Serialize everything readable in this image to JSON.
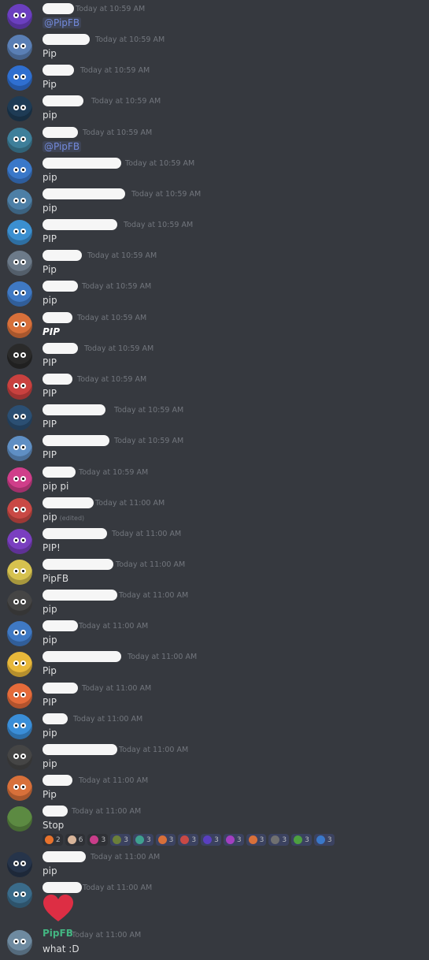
{
  "channel": {
    "messages": [
      {
        "time": "Today at 10:59 AM",
        "text": "@PipFB",
        "mention": true
      },
      {
        "time": "Today at 10:59 AM",
        "text": "Pip"
      },
      {
        "time": "Today at 10:59 AM",
        "text": "Pip"
      },
      {
        "time": "Today at 10:59 AM",
        "text": "pip"
      },
      {
        "time": "Today at 10:59 AM",
        "text": "@PipFB",
        "mention": true
      },
      {
        "time": "Today at 10:59 AM",
        "text": "pip"
      },
      {
        "time": "Today at 10:59 AM",
        "text": "pip"
      },
      {
        "time": "Today at 10:59 AM",
        "text": "PIP"
      },
      {
        "time": "Today at 10:59 AM",
        "text": "Pip"
      },
      {
        "time": "Today at 10:59 AM",
        "text": "pip"
      },
      {
        "time": "Today at 10:59 AM",
        "text": "PIP",
        "bold": true
      },
      {
        "time": "Today at 10:59 AM",
        "text": "PIP"
      },
      {
        "time": "Today at 10:59 AM",
        "text": "PIP"
      },
      {
        "time": "Today at 10:59 AM",
        "text": "PIP"
      },
      {
        "time": "Today at 10:59 AM",
        "text": "PIP"
      },
      {
        "time": "Today at 10:59 AM",
        "text": "pip pi"
      },
      {
        "time": "Today at 11:00 AM",
        "text": "pip",
        "edited": "(edited)"
      },
      {
        "time": "Today at 11:00 AM",
        "text": "PIP!"
      },
      {
        "time": "Today at 11:00 AM",
        "text": "PipFB"
      },
      {
        "time": "Today at 11:00 AM",
        "text": "pip"
      },
      {
        "time": "Today at 11:00 AM",
        "text": "pip"
      },
      {
        "time": "Today at 11:00 AM",
        "text": "Pip"
      },
      {
        "time": "Today at 11:00 AM",
        "text": "PIP"
      },
      {
        "time": "Today at 11:00 AM",
        "text": "pip"
      },
      {
        "time": "Today at 11:00 AM",
        "text": "pip"
      },
      {
        "time": "Today at 11:00 AM",
        "text": "Pip"
      },
      {
        "time": "Today at 11:00 AM",
        "text": "Stop"
      },
      {
        "time": "Today at 11:00 AM",
        "text": "pip"
      },
      {
        "time": "Today at 11:00 AM",
        "text": ""
      },
      {
        "time": "Today at 11:00 AM",
        "text": "what :D",
        "author": "PipFB"
      }
    ],
    "reactions": [
      {
        "count": "2",
        "me": false
      },
      {
        "count": "6",
        "me": false
      },
      {
        "count": "3",
        "me": false
      },
      {
        "count": "3",
        "me": true
      },
      {
        "count": "3",
        "me": true
      },
      {
        "count": "3",
        "me": true
      },
      {
        "count": "3",
        "me": true
      },
      {
        "count": "3",
        "me": true
      },
      {
        "count": "3",
        "me": true
      },
      {
        "count": "3",
        "me": true
      },
      {
        "count": "3",
        "me": true
      },
      {
        "count": "3",
        "me": true
      },
      {
        "count": "3",
        "me": true
      }
    ],
    "heart_emoji": "heart"
  },
  "colors": {
    "background": "#36393f",
    "timestamp": "#72767d",
    "mention": "#7289da",
    "pipfb_name": "#43b581",
    "heart": "#dd2e44"
  }
}
